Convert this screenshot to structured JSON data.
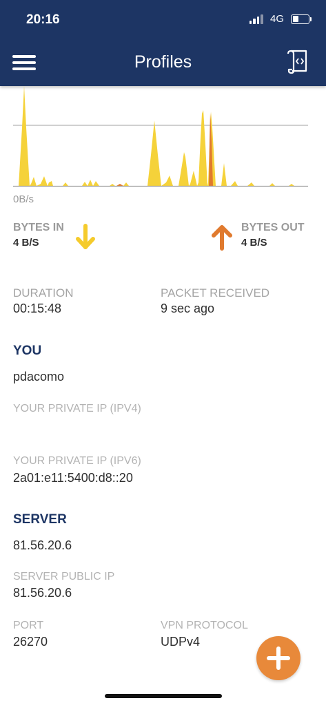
{
  "status_bar": {
    "time": "20:16",
    "network": "4G"
  },
  "header": {
    "title": "Profiles",
    "menu_icon": "hamburger-menu-icon",
    "log_icon": "log-file-icon"
  },
  "traffic": {
    "scale_label": "0B/s",
    "in_color": "#f5d23a",
    "out_color": "#e07a2e"
  },
  "bytes_in": {
    "label": "BYTES IN",
    "value": "4 B/S",
    "icon": "arrow-down-icon"
  },
  "bytes_out": {
    "label": "BYTES OUT",
    "value": "4 B/S",
    "icon": "arrow-up-icon"
  },
  "duration": {
    "label": "DURATION",
    "value": "00:15:48"
  },
  "packet_received": {
    "label": "PACKET RECEIVED",
    "value": "9 sec ago"
  },
  "you": {
    "heading": "YOU",
    "username": "pdacomo",
    "private_ipv4_label": "YOUR PRIVATE IP (IPV4)",
    "private_ipv4_value": "",
    "private_ipv6_label": "YOUR PRIVATE IP (IPV6)",
    "private_ipv6_value": "2a01:e11:5400:d8::20"
  },
  "server": {
    "heading": "SERVER",
    "name": "81.56.20.6",
    "public_ip_label": "SERVER PUBLIC IP",
    "public_ip_value": "81.56.20.6",
    "port_label": "PORT",
    "port_value": "26270",
    "protocol_label": "VPN PROTOCOL",
    "protocol_value": "UDPv4"
  },
  "fab": {
    "icon": "plus-icon",
    "color": "#e8893a"
  }
}
